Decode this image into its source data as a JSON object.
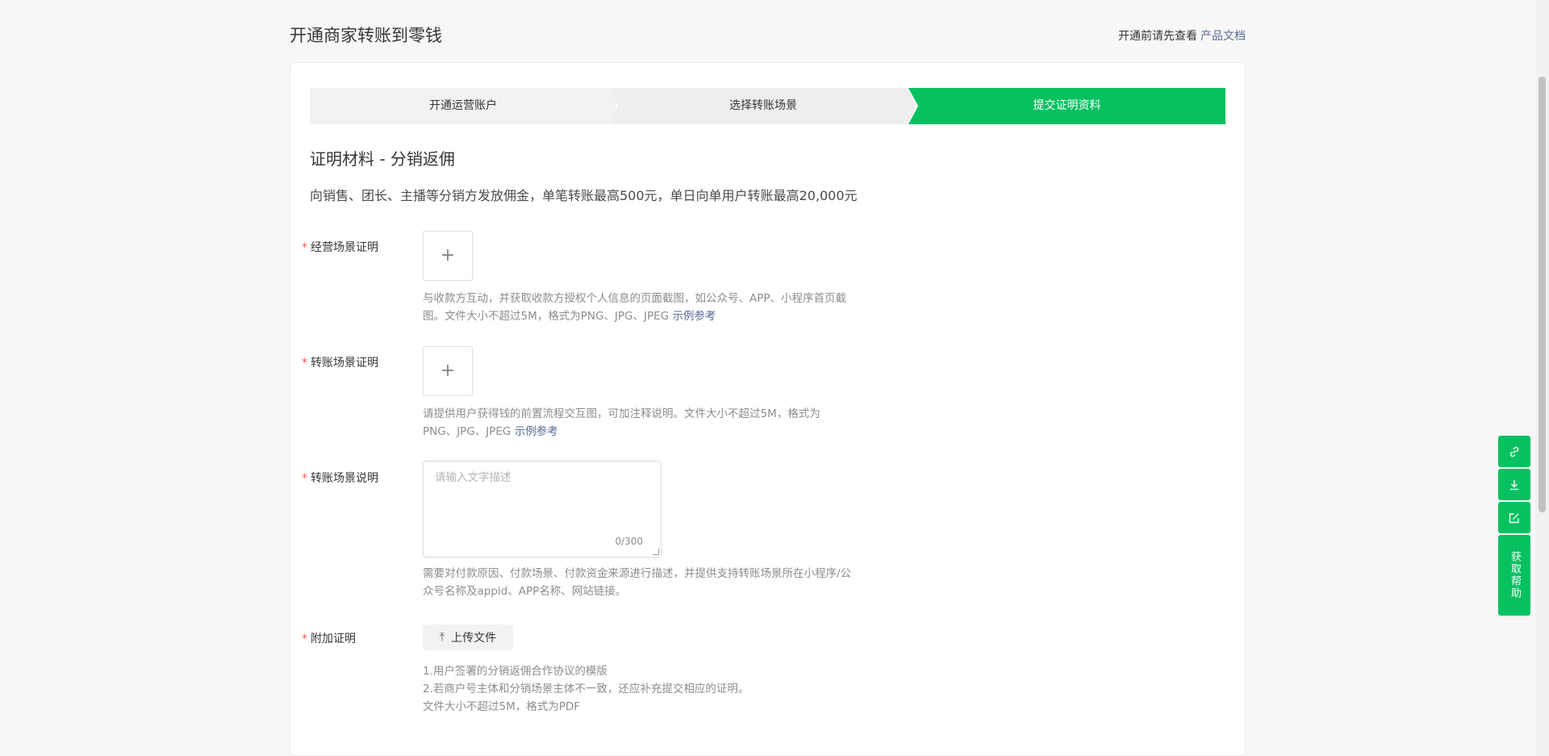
{
  "header": {
    "title": "开通商家转账到零钱",
    "doc_hint_prefix": "开通前请先查看",
    "doc_link": "产品文档"
  },
  "steps": [
    {
      "label": "开通运营账户",
      "state": "done"
    },
    {
      "label": "选择转账场景",
      "state": "done"
    },
    {
      "label": "提交证明资料",
      "state": "active"
    }
  ],
  "section": {
    "title": "证明材料 - 分销返佣",
    "description": "向销售、团长、主播等分销方发放佣金，单笔转账最高500元，单日向单用户转账最高20,000元"
  },
  "form": {
    "required_mark": "*",
    "business_proof": {
      "label": "经营场景证明",
      "plus": "+",
      "hint": "与收款方互动，并获取收款方授权个人信息的页面截图，如公众号、APP、小程序首页截图。文件大小不超过5M，格式为PNG、JPG、JPEG",
      "example_link": "示例参考"
    },
    "transfer_proof": {
      "label": "转账场景证明",
      "plus": "+",
      "hint": "请提供用户获得钱的前置流程交互图，可加注释说明。文件大小不超过5M，格式为PNG、JPG、JPEG",
      "example_link": "示例参考"
    },
    "transfer_desc": {
      "label": "转账场景说明",
      "placeholder": "请输入文字描述",
      "counter": "0/300",
      "hint": "需要对付款原因、付款场景、付款资金来源进行描述，并提供支持转账场景所在小程序/公众号名称及appid、APP名称、网站链接。"
    },
    "extra_proof": {
      "label": "附加证明",
      "button": "上传文件",
      "hints": [
        "1.用户签署的分销返佣合作协议的模版",
        "2.若商户号主体和分销场景主体不一致，还应补充提交相应的证明。",
        "文件大小不超过5M，格式为PDF"
      ]
    }
  },
  "float_tools": {
    "help_label": "获取帮助",
    "icons": [
      "link-icon",
      "download-icon",
      "edit-icon"
    ]
  },
  "colors": {
    "accent": "#07c160",
    "link": "#576b95",
    "required": "#fa5151"
  }
}
